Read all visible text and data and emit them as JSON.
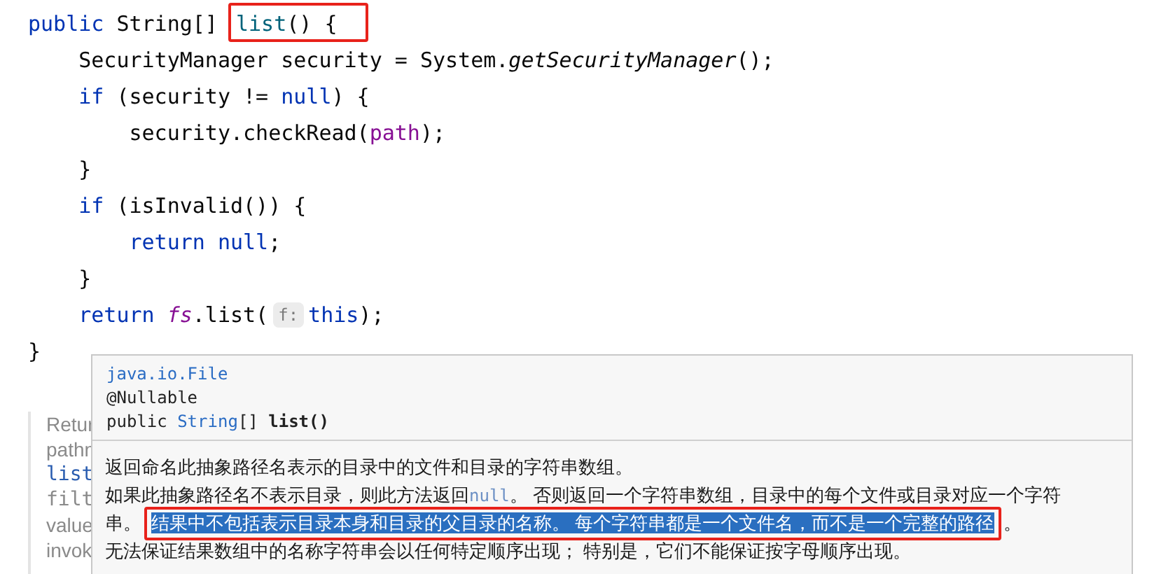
{
  "code": {
    "lines": [
      {
        "tokens": [
          {
            "kind": "keyword",
            "text": "public "
          },
          {
            "kind": "plain",
            "text": "String[] "
          },
          {
            "kind": "declaration",
            "text": "list",
            "annotated": true
          },
          {
            "kind": "plain",
            "text": "() {",
            "annotated": true
          }
        ]
      },
      {
        "tokens": [
          {
            "kind": "plain",
            "text": "    SecurityManager security = System."
          },
          {
            "kind": "static",
            "text": "getSecurityManager"
          },
          {
            "kind": "plain",
            "text": "();"
          }
        ]
      },
      {
        "tokens": [
          {
            "kind": "keyword",
            "text": "    if "
          },
          {
            "kind": "plain",
            "text": "(security != "
          },
          {
            "kind": "keyword",
            "text": "null"
          },
          {
            "kind": "plain",
            "text": ") {"
          }
        ]
      },
      {
        "tokens": [
          {
            "kind": "plain",
            "text": "        security.checkRead("
          },
          {
            "kind": "field",
            "text": "path"
          },
          {
            "kind": "plain",
            "text": ");"
          }
        ]
      },
      {
        "tokens": [
          {
            "kind": "plain",
            "text": "    }"
          }
        ]
      },
      {
        "tokens": [
          {
            "kind": "keyword",
            "text": "    if "
          },
          {
            "kind": "plain",
            "text": "(isInvalid()) {"
          }
        ]
      },
      {
        "tokens": [
          {
            "kind": "keyword",
            "text": "        return null"
          },
          {
            "kind": "plain",
            "text": ";"
          }
        ]
      },
      {
        "tokens": [
          {
            "kind": "plain",
            "text": "    }"
          }
        ]
      },
      {
        "tokens": [
          {
            "kind": "keyword",
            "text": "    return "
          },
          {
            "kind": "static_field",
            "text": "fs"
          },
          {
            "kind": "plain",
            "text": ".list("
          },
          {
            "kind": "hint",
            "text": "f:"
          },
          {
            "kind": "keyword",
            "text": "this"
          },
          {
            "kind": "plain",
            "text": ");"
          }
        ]
      },
      {
        "tokens": [
          {
            "kind": "plain",
            "text": "}"
          }
        ]
      }
    ]
  },
  "background_doc": {
    "lines": [
      {
        "kind": "text",
        "text": "Retur"
      },
      {
        "kind": "text",
        "text": "pathn"
      },
      {
        "kind": "link",
        "text": "list"
      },
      {
        "kind": "code",
        "text": "filt"
      },
      {
        "kind": "text",
        "text": "value"
      },
      {
        "kind": "text",
        "text": "invok"
      }
    ]
  },
  "popup": {
    "header": [
      {
        "tokens": [
          {
            "kind": "link",
            "text": "java.io.File"
          }
        ]
      },
      {
        "tokens": [
          {
            "kind": "plain",
            "text": "@Nullable"
          }
        ]
      },
      {
        "tokens": [
          {
            "kind": "plain",
            "text": "public "
          },
          {
            "kind": "link",
            "text": "String"
          },
          {
            "kind": "plain",
            "text": "[] "
          },
          {
            "kind": "bold",
            "text": "list()"
          }
        ]
      }
    ],
    "body": [
      {
        "tokens": [
          {
            "kind": "text",
            "text": "返回命名此抽象路径名表示的目录中的文件和目录的字符串数组。"
          }
        ]
      },
      {
        "tokens": [
          {
            "kind": "text",
            "text": "如果此抽象路径名不表示目录，则此方法返回"
          },
          {
            "kind": "code",
            "text": "null"
          },
          {
            "kind": "text",
            "text": "。 否则返回一个字符串数组，目录中的每个文件或目录对应一个字符"
          }
        ]
      },
      {
        "tokens": [
          {
            "kind": "text",
            "text": "串。"
          },
          {
            "kind": "highlight",
            "text": "结果中不包括表示目录本身和目录的父目录的名称。 每个字符串都是一个文件名，而不是一个完整的路径",
            "annotated": true
          },
          {
            "kind": "text",
            "text": "。"
          }
        ]
      },
      {
        "tokens": [
          {
            "kind": "text",
            "text": "无法保证结果数组中的名称字符串会以任何特定顺序出现； 特别是，它们不能保证按字母顺序出现。"
          }
        ]
      }
    ]
  }
}
